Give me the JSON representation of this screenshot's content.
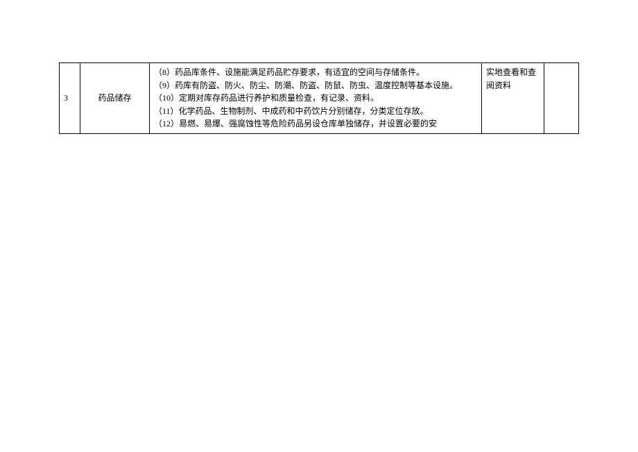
{
  "row": {
    "number": "3",
    "category": "药品储存",
    "lines": [
      "（8）药品库条件、设施能满足药品贮存要求，有适宜的空间与存储条件。",
      "（9）药库有防盗、防火、防尘、防潮、防盗、防鼠、防虫、温度控制等基本设施。",
      "（10）定期对库存药品进行养护和质量检查，有记录、资料。",
      "（11）化学药品、生物制剂、中成药和中药饮片分别储存，分类定位存放。",
      "（12）易燃、易爆、强腐蚀性等危险药品另设仓库单独储存，并设置必要的安"
    ],
    "check_method": "实地查看和查阅资料",
    "remark": ""
  }
}
